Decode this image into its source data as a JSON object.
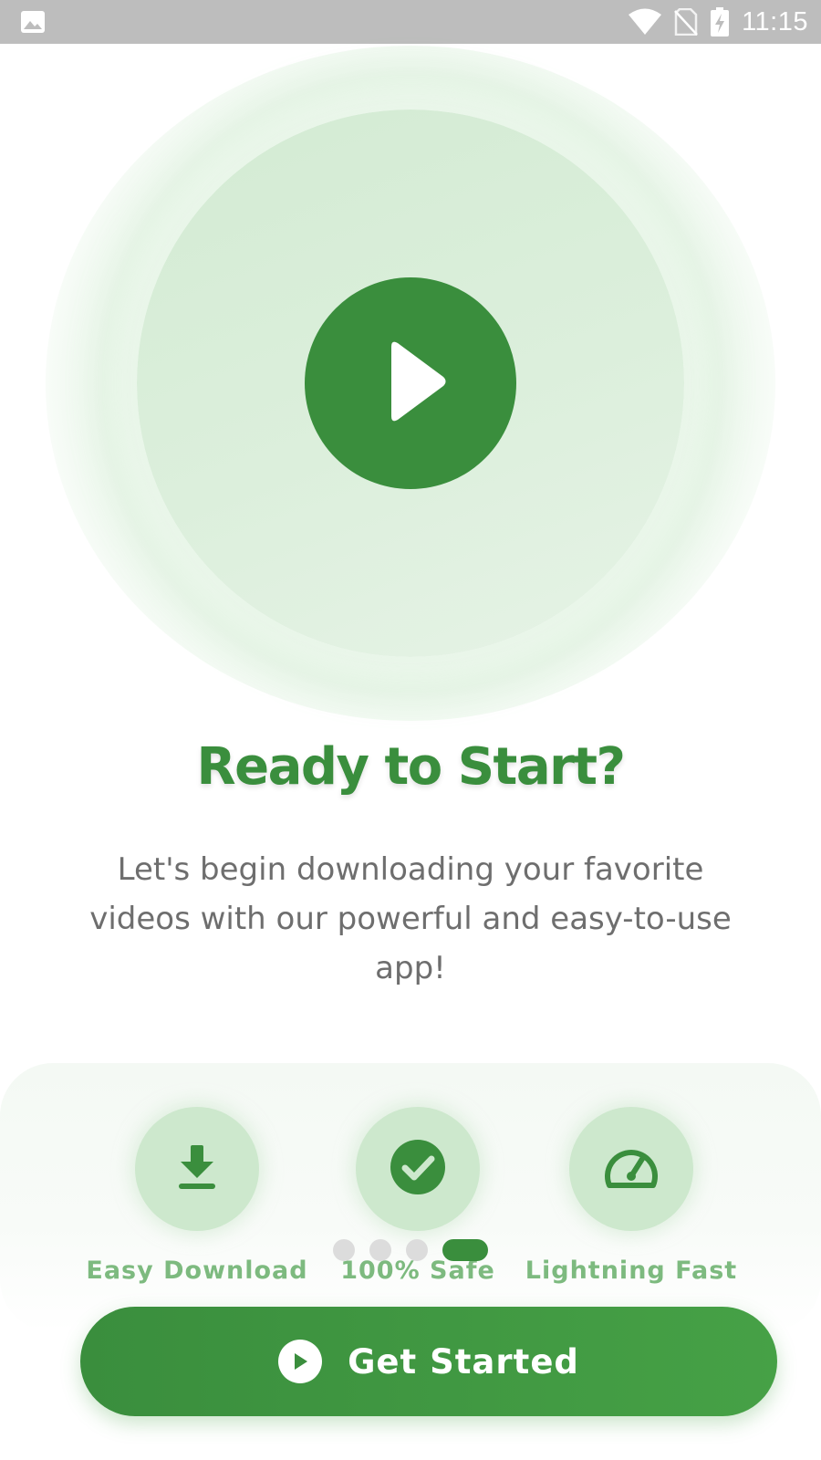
{
  "status_bar": {
    "time": "11:15",
    "icons": [
      "image-notification-icon",
      "wifi-icon",
      "no-sim-icon",
      "battery-charging-icon"
    ]
  },
  "hero": {
    "icon": "play-icon"
  },
  "onboarding": {
    "title": "Ready to Start?",
    "subtitle": "Let's begin downloading your favorite videos with our powerful and easy-to-use app!"
  },
  "features": [
    {
      "label": "Easy Download",
      "icon": "download-icon"
    },
    {
      "label": "100% Safe",
      "icon": "check-circle-icon"
    },
    {
      "label": "Lightning Fast",
      "icon": "speedometer-icon"
    }
  ],
  "pagination": {
    "total_pages": 4,
    "current_page": 4
  },
  "cta": {
    "label": "Get Started",
    "icon": "play-circle-icon"
  },
  "colors": {
    "brand_green": "#3a8e3d",
    "feature_label": "#7dba7f",
    "hero_circle": "#d8edd8",
    "subtitle_text": "#6e6e6e",
    "status_bar": "#bdbdbd"
  }
}
